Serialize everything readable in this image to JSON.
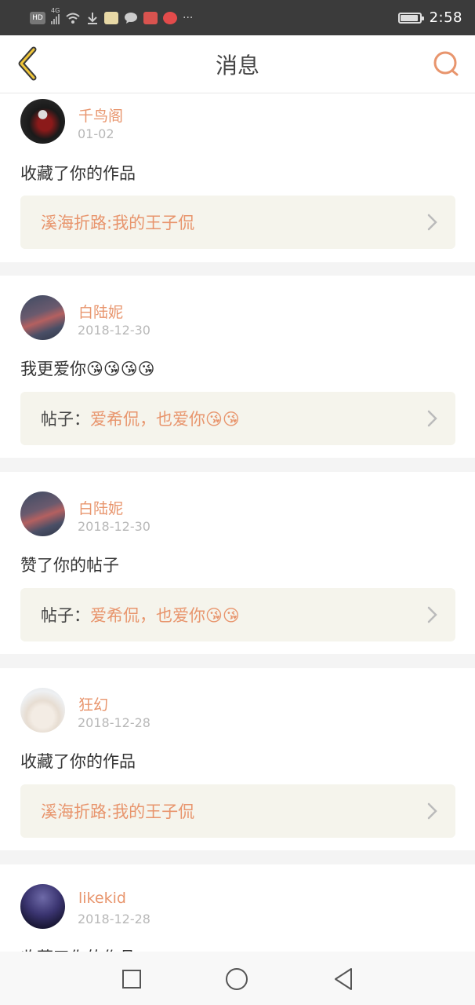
{
  "status_bar": {
    "icons": [
      "HD",
      "4G-signal",
      "wifi",
      "download",
      "app-notify",
      "message",
      "app-red",
      "app-weibo",
      "more"
    ],
    "hd_label": "HD",
    "lte_label": "4G",
    "more_label": "···",
    "time": "2:58"
  },
  "header": {
    "title": "消息",
    "back_icon": "chevron-left-icon",
    "search_icon": "search-icon",
    "accent_color": "#e8956d"
  },
  "messages": [
    {
      "user": "千鸟阁",
      "date": "01-02",
      "action": "收藏了你的作品",
      "ref_prefix": "",
      "ref_title": "溪海折路:我的王子侃"
    },
    {
      "user": "白陆妮",
      "date": "2018-12-30",
      "action": "我更爱你😘😘😘😘",
      "ref_prefix": "帖子：",
      "ref_title": "爱希侃，也爱你😘😘"
    },
    {
      "user": "白陆妮",
      "date": "2018-12-30",
      "action": "赞了你的帖子",
      "ref_prefix": "帖子：",
      "ref_title": "爱希侃，也爱你😘😘"
    },
    {
      "user": "狂幻",
      "date": "2018-12-28",
      "action": "收藏了你的作品",
      "ref_prefix": "",
      "ref_title": "溪海折路:我的王子侃"
    },
    {
      "user": "likekid",
      "date": "2018-12-28",
      "action": "收藏了你的作品",
      "ref_prefix": "",
      "ref_title": ""
    }
  ],
  "nav_bar": {
    "recents_icon": "square-icon",
    "home_icon": "circle-icon",
    "back_icon": "triangle-back-icon"
  }
}
